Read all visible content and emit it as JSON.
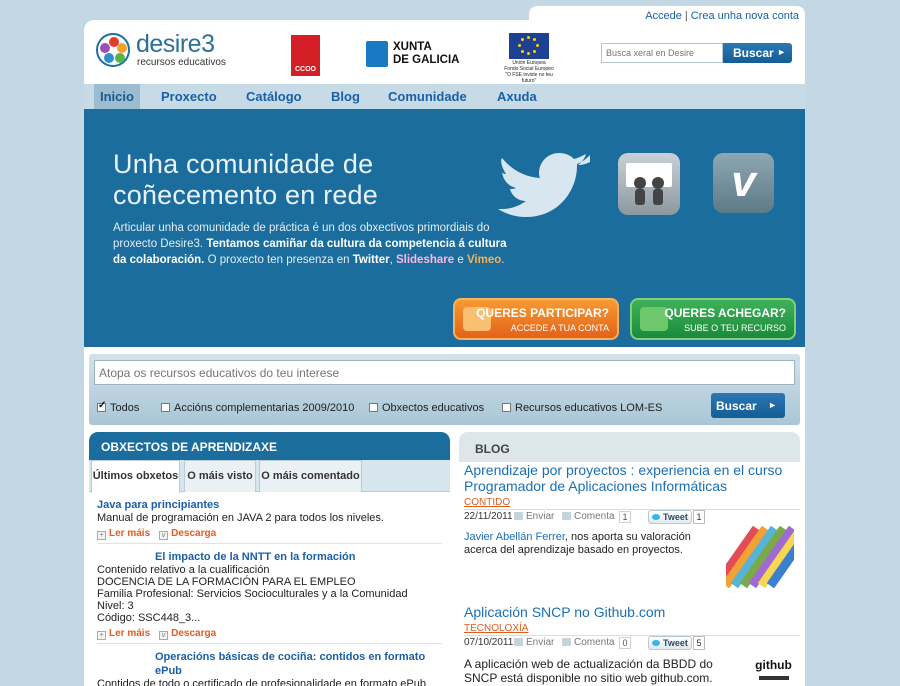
{
  "top_links": {
    "login": "Accede",
    "register": "Crea unha nova conta"
  },
  "logo": {
    "name": "desire3",
    "subtitle": "recursos educativos"
  },
  "sponsors": {
    "ccoo": "CCOO",
    "xunta_line1": "XUNTA",
    "xunta_line2": "DE GALICIA",
    "ue_line1": "Unión Europea",
    "ue_line2": "Fondo Social Europeo",
    "ue_line3": "\"O FSE inviste no teu futuro\""
  },
  "header_search": {
    "placeholder": "Busca xeral en Desire",
    "button": "Buscar"
  },
  "nav": [
    "Inicio",
    "Proxecto",
    "Catálogo",
    "Blog",
    "Comunidade",
    "Axuda"
  ],
  "hero": {
    "title_line1": "Unha comunidade de",
    "title_line2": "coñecemento en rede",
    "text_part1": "Articular unha comunidade de práctica é un dos obxectivos primordiais do proxecto Desire3.",
    "text_part2": "Tentamos camiñar da cultura da competencia á cultura da colaboración.",
    "text_part3": "O proxecto ten presenza en",
    "link_twitter": "Twitter",
    "comma": ",",
    "link_slideshare": "Slideshare",
    "and": "e",
    "link_vimeo": "Vimeo",
    "period": ".",
    "cta_participate": {
      "title": "QUERES PARTICIPAR?",
      "subtitle": "ACCEDE A TUA CONTA"
    },
    "cta_contribute": {
      "title": "QUERES ACHEGAR?",
      "subtitle": "SUBE O TEU RECURSO"
    }
  },
  "resource_search": {
    "placeholder": "Atopa os recursos educativos do teu interese",
    "filters": [
      {
        "label": "Todos",
        "checked": true
      },
      {
        "label": "Accións complementarias 2009/2010",
        "checked": false
      },
      {
        "label": "Obxectos educativos",
        "checked": false
      },
      {
        "label": "Recursos educativos LOM-ES",
        "checked": false
      }
    ],
    "button": "Buscar"
  },
  "objects": {
    "heading": "OBXECTOS DE APRENDIZAXE",
    "tabs": [
      "Últimos obxetos",
      "O máis visto",
      "O máis comentado"
    ],
    "more_label": "Ler máis",
    "download_label": "Descarga",
    "items": [
      {
        "title": "Java para principiantes",
        "lines": [
          "Manual de programación en JAVA 2 para todos los niveles."
        ]
      },
      {
        "title": "El impacto de la NNTT en la formación",
        "lines": [
          "Contenido relativo a la cualificación",
          "DOCENCIA DE LA FORMACIÓN PARA EL EMPLEO",
          "Familia Profesional: Servicios Socioculturales y a la Comunidad",
          "Nivel: 3",
          "Código: SSC448_3..."
        ]
      },
      {
        "title": "Operacións básicas de cociña: contidos en formato ePub",
        "lines": [
          "Contidos de todo o certificado de profesionalidade en formato ePub"
        ]
      }
    ]
  },
  "blog": {
    "heading": "BLOG",
    "send_label": "Enviar",
    "comment_label": "Comenta",
    "tweet_label": "Tweet",
    "posts": [
      {
        "title": "Aprendizaje por proyectos : experiencia en el curso Programador de Aplicaciones Informáticas",
        "category": "CONTIDO",
        "date": "22/11/2011",
        "comments": "1",
        "tweets": "1",
        "author": "Javier Abellán Ferrer",
        "body": ", nos aporta su valoración acerca del aprendizaje basado en proyectos."
      },
      {
        "title": "Aplicación SNCP no Github.com",
        "category": "TECNOLOXÍA",
        "date": "07/10/2011",
        "comments": "0",
        "tweets": "5",
        "body": "A aplicación web de actualización da BBDD do SNCP  está disponible no sitio web github.com.",
        "thumb_text": "github"
      }
    ]
  },
  "colors": {
    "brand_blue": "#1b6d9e",
    "link_blue": "#1a5fa8",
    "accent_orange": "#e05d1d",
    "accent_green": "#1a8a3a"
  }
}
